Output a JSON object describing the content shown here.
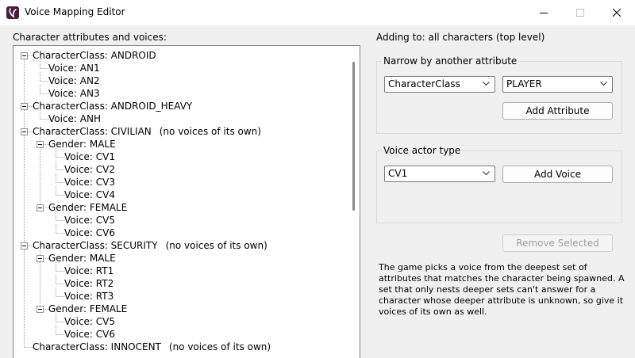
{
  "window": {
    "title": "Voice Mapping Editor"
  },
  "left": {
    "label": "Character attributes and voices:",
    "tree": [
      {
        "text": "CharacterClass: ANDROID",
        "depth": 0,
        "expanded": true
      },
      {
        "text": "Voice: AN1",
        "depth": 1
      },
      {
        "text": "Voice: AN2",
        "depth": 1
      },
      {
        "text": "Voice: AN3",
        "depth": 1
      },
      {
        "text": "CharacterClass: ANDROID_HEAVY",
        "depth": 0,
        "expanded": true
      },
      {
        "text": "Voice: ANH",
        "depth": 1
      },
      {
        "text": "CharacterClass: CIVILIAN",
        "note": "(no voices of its own)",
        "depth": 0,
        "expanded": true
      },
      {
        "text": "Gender: MALE",
        "depth": 1,
        "expanded": true
      },
      {
        "text": "Voice: CV1",
        "depth": 2
      },
      {
        "text": "Voice: CV2",
        "depth": 2
      },
      {
        "text": "Voice: CV3",
        "depth": 2
      },
      {
        "text": "Voice: CV4",
        "depth": 2
      },
      {
        "text": "Gender: FEMALE",
        "depth": 1,
        "expanded": true
      },
      {
        "text": "Voice: CV5",
        "depth": 2
      },
      {
        "text": "Voice: CV6",
        "depth": 2
      },
      {
        "text": "CharacterClass: SECURITY",
        "note": "(no voices of its own)",
        "depth": 0,
        "expanded": true
      },
      {
        "text": "Gender: MALE",
        "depth": 1,
        "expanded": true
      },
      {
        "text": "Voice: RT1",
        "depth": 2
      },
      {
        "text": "Voice: RT2",
        "depth": 2
      },
      {
        "text": "Voice: RT3",
        "depth": 2
      },
      {
        "text": "Gender: FEMALE",
        "depth": 1,
        "expanded": true
      },
      {
        "text": "Voice: CV5",
        "depth": 2
      },
      {
        "text": "Voice: CV6",
        "depth": 2
      },
      {
        "text": "CharacterClass: INNOCENT",
        "note": "(no voices of its own)",
        "depth": 0,
        "expanded": true
      }
    ]
  },
  "right": {
    "adding_to": "Adding to: all characters (top level)",
    "narrow_group": {
      "title": "Narrow by another attribute",
      "attribute_value": "CharacterClass",
      "value_value": "PLAYER",
      "add_attribute_label": "Add Attribute"
    },
    "voice_group": {
      "title": "Voice actor type",
      "voice_value": "CV1",
      "add_voice_label": "Add Voice"
    },
    "remove_label": "Remove Selected",
    "info_text": "The game picks a voice from the deepest set of attributes that matches the character being spawned. A set that only nests deeper sets can't answer for a character whose deeper attribute is unknown, so give it voices of its own as well."
  },
  "colors": {
    "window_bg": "#f0f0f0",
    "titlebar_bg": "#ffffff",
    "icon_bg": "#4a1d3f",
    "disabled_text": "#a0a0a0"
  },
  "icons": {
    "app": "app-logo-icon",
    "minimize": "minimize-icon",
    "maximize": "maximize-icon",
    "close": "close-icon",
    "dropdown": "chevron-down-icon"
  }
}
